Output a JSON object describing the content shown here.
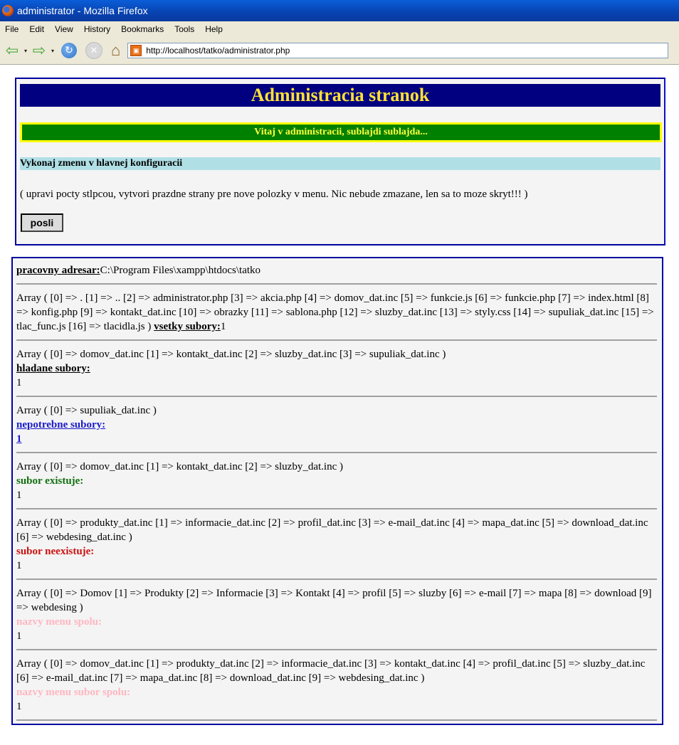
{
  "window": {
    "title": "administrator - Mozilla Firefox"
  },
  "menu": [
    "File",
    "Edit",
    "View",
    "History",
    "Bookmarks",
    "Tools",
    "Help"
  ],
  "toolbar": {
    "url": "http://localhost/tatko/administrator.php"
  },
  "admin": {
    "title": "Administracia stranok",
    "welcome": "Vitaj v administracii, sublajdi sublajda...",
    "config_heading": "Vykonaj zmenu v hlavnej konfiguracii",
    "config_desc": "( upravi pocty stlpcou, vytvori prazdne strany pre nove polozky v menu. Nic nebude zmazane, len sa to moze skryt!!! )",
    "send_label": "posli"
  },
  "info": {
    "workdir_label": "pracovny adresar:",
    "workdir_value": "C:\\Program Files\\xampp\\htdocs\\tatko",
    "all_array": "Array ( [0] => . [1] => .. [2] => administrator.php [3] => akcia.php [4] => domov_dat.inc [5] => funkcie.js [6] => funkcie.php [7] => index.html [8] => konfig.php [9] => kontakt_dat.inc [10] => obrazky [11] => sablona.php [12] => sluzby_dat.inc [13] => styly.css [14] => supuliak_dat.inc [15] => tlac_func.js [16] => tlacidla.js )",
    "all_label": "vsetky subory:",
    "all_value": "1",
    "searched_array": "Array ( [0] => domov_dat.inc [1] => kontakt_dat.inc [2] => sluzby_dat.inc [3] => supuliak_dat.inc )",
    "searched_label": "hladane subory:",
    "searched_value": "1",
    "unneeded_array": "Array ( [0] => supuliak_dat.inc )",
    "unneeded_label": "nepotrebne subory:",
    "unneeded_value": "1",
    "exists_array": "Array ( [0] => domov_dat.inc [1] => kontakt_dat.inc [2] => sluzby_dat.inc )",
    "exists_label": "subor existuje:",
    "exists_value": "1",
    "notexists_array": "Array ( [0] => produkty_dat.inc [1] => informacie_dat.inc [2] => profil_dat.inc [3] => e-mail_dat.inc [4] => mapa_dat.inc [5] => download_dat.inc [6] => webdesing_dat.inc )",
    "notexists_label": "subor neexistuje:",
    "notexists_value": "1",
    "menunames_array": "Array ( [0] => Domov [1] => Produkty [2] => Informacie [3] => Kontakt [4] => profil [5] => sluzby [6] => e-mail [7] => mapa [8] => download [9] => webdesing )",
    "menunames_label": "nazvy menu spolu:",
    "menunames_value": "1",
    "menufiles_array": "Array ( [0] => domov_dat.inc [1] => produkty_dat.inc [2] => informacie_dat.inc [3] => kontakt_dat.inc [4] => profil_dat.inc [5] => sluzby_dat.inc [6] => e-mail_dat.inc [7] => mapa_dat.inc [8] => download_dat.inc [9] => webdesing_dat.inc )",
    "menufiles_label": "nazvy menu subor spolu:",
    "menufiles_value": "1"
  }
}
